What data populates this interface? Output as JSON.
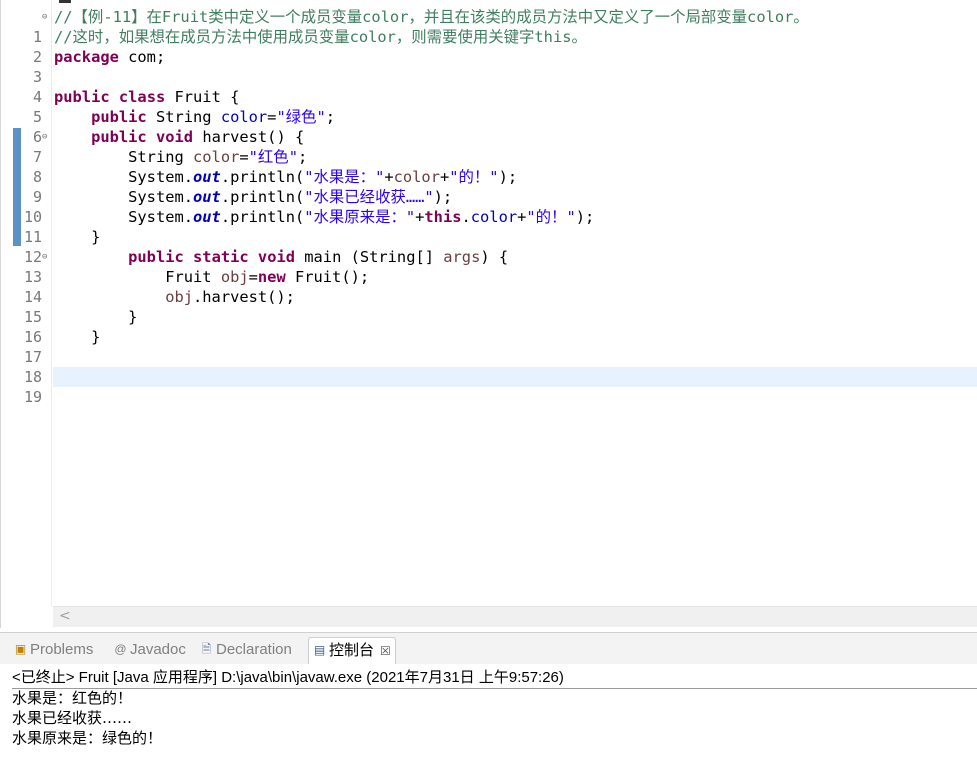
{
  "editor": {
    "lines": [
      {
        "n": "1",
        "fold": true
      },
      {
        "n": "2"
      },
      {
        "n": "3"
      },
      {
        "n": "4"
      },
      {
        "n": "5"
      },
      {
        "n": "6"
      },
      {
        "n": "7",
        "fold": true
      },
      {
        "n": "8"
      },
      {
        "n": "9"
      },
      {
        "n": "10"
      },
      {
        "n": "11"
      },
      {
        "n": "12"
      },
      {
        "n": "13",
        "fold": true
      },
      {
        "n": "14"
      },
      {
        "n": "15"
      },
      {
        "n": "16"
      },
      {
        "n": "17"
      },
      {
        "n": "18"
      },
      {
        "n": "19"
      }
    ],
    "code": {
      "l1_comment": "//【例-11】在Fruit类中定义一个成员变量color，并且在该类的成员方法中又定义了一个局部变量color。",
      "l2_comment": "//这时，如果想在成员方法中使用成员变量color，则需要使用关键字this。",
      "l3_kw": "package",
      "l3_rest": " com;",
      "l5_kw1": "public",
      "l5_kw2": "class",
      "l5_rest": " Fruit {",
      "l6_kw": "public",
      "l6_type": " String ",
      "l6_field": "color",
      "l6_eq": "=",
      "l6_str": "\"绿色\"",
      "l6_end": ";",
      "l7_kw1": "public",
      "l7_kw2": "void",
      "l7_rest": " harvest() {",
      "l8_type": "String ",
      "l8_var": "color",
      "l8_eq": "=",
      "l8_str": "\"红色\"",
      "l8_end": ";",
      "l9_a": "System.",
      "l9_out": "out",
      "l9_b": ".println(",
      "l9_str1": "\"水果是：\"",
      "l9_c": "+",
      "l9_var": "color",
      "l9_d": "+",
      "l9_str2": "\"的！\"",
      "l9_e": ");",
      "l10_a": "System.",
      "l10_out": "out",
      "l10_b": ".println(",
      "l10_str": "\"水果已经收获……\"",
      "l10_e": ");",
      "l11_a": "System.",
      "l11_out": "out",
      "l11_b": ".println(",
      "l11_str1": "\"水果原来是：\"",
      "l11_c": "+",
      "l11_this": "this",
      "l11_dot": ".",
      "l11_field": "color",
      "l11_d": "+",
      "l11_str2": "\"的！\"",
      "l11_e": ");",
      "l12": "}",
      "l13_kw1": "public",
      "l13_kw2": "static",
      "l13_kw3": "void",
      "l13_a": " main (String[] ",
      "l13_arg": "args",
      "l13_b": ") {",
      "l14_a": "Fruit ",
      "l14_var": "obj",
      "l14_eq": "=",
      "l14_kw": "new",
      "l14_b": " Fruit();",
      "l15_var": "obj",
      "l15_b": ".harvest();",
      "l16": "}",
      "l17": "}"
    }
  },
  "panel": {
    "tabs": [
      {
        "label": "Problems",
        "icon": "problems-icon"
      },
      {
        "label": "Javadoc",
        "icon": "javadoc-icon"
      },
      {
        "label": "Declaration",
        "icon": "declaration-icon"
      },
      {
        "label": "控制台",
        "icon": "console-icon",
        "active": true
      }
    ],
    "close_glyph": "☒",
    "console_header": "<已终止> Fruit [Java 应用程序] D:\\java\\bin\\javaw.exe  (2021年7月31日 上午9:57:26)",
    "output": [
      "水果是：红色的！",
      "水果已经收获……",
      "水果原来是：绿色的！"
    ]
  },
  "colors": {
    "keyword": "#7f0055",
    "string": "#2a00ff",
    "field": "#0000c0",
    "comment": "#3f7f5f",
    "local_var": "#6a3e3e",
    "current_line": "#e8f2fe"
  }
}
